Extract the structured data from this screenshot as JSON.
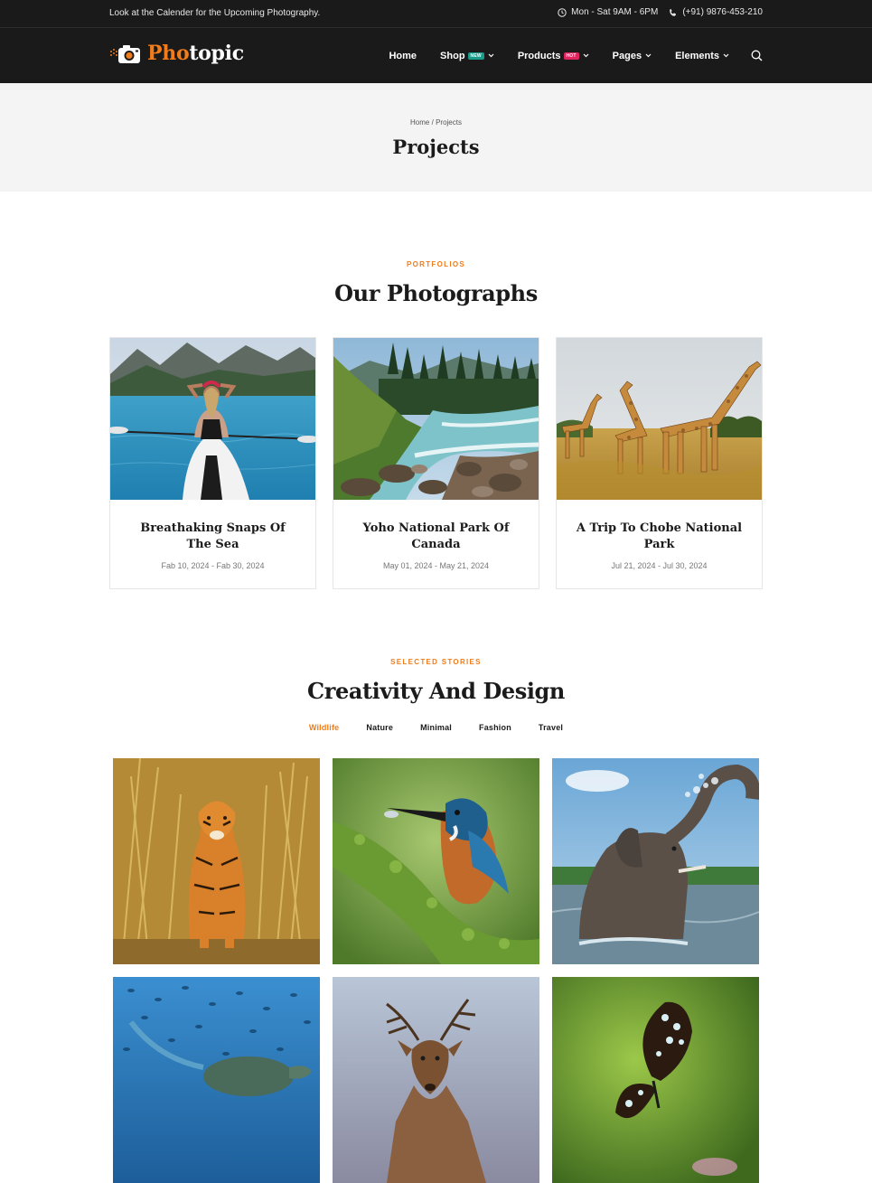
{
  "topbar": {
    "message": "Look at the Calender for the Upcoming Photography.",
    "hours": "Mon - Sat 9AM - 6PM",
    "phone": "(+91) 9876-453-210"
  },
  "brand": {
    "accent": "Pho",
    "rest": "topic",
    "accent_color": "#f07c1b"
  },
  "nav": {
    "items": [
      {
        "label": "Home"
      },
      {
        "label": "Shop",
        "badge": "NEW"
      },
      {
        "label": "Products",
        "badge": "HOT"
      },
      {
        "label": "Pages"
      },
      {
        "label": "Elements"
      }
    ],
    "search_icon": "search-icon"
  },
  "page_header": {
    "breadcrumb_home": "Home",
    "breadcrumb_sep": "/",
    "breadcrumb_current": "Projects",
    "title": "Projects"
  },
  "portfolio": {
    "eyebrow": "PORTFOLIOS",
    "title": "Our Photographs",
    "cards": [
      {
        "title": "Breathaking Snaps Of The Sea",
        "dates": "Fab 10, 2024 - Fab 30, 2024"
      },
      {
        "title": "Yoho National Park Of Canada",
        "dates": "May 01, 2024 - May 21, 2024"
      },
      {
        "title": "A Trip To Chobe National Park",
        "dates": "Jul 21, 2024 - Jul 30, 2024"
      }
    ]
  },
  "stories": {
    "eyebrow": "SELECTED STORIES",
    "title": "Creativity And Design",
    "filters": [
      "Wildlife",
      "Nature",
      "Minimal",
      "Fashion",
      "Travel"
    ],
    "active_filter": "Wildlife"
  },
  "colors": {
    "dark": "#1a1a1a",
    "accent": "#f07c1b",
    "light_bg": "#f4f4f4"
  }
}
